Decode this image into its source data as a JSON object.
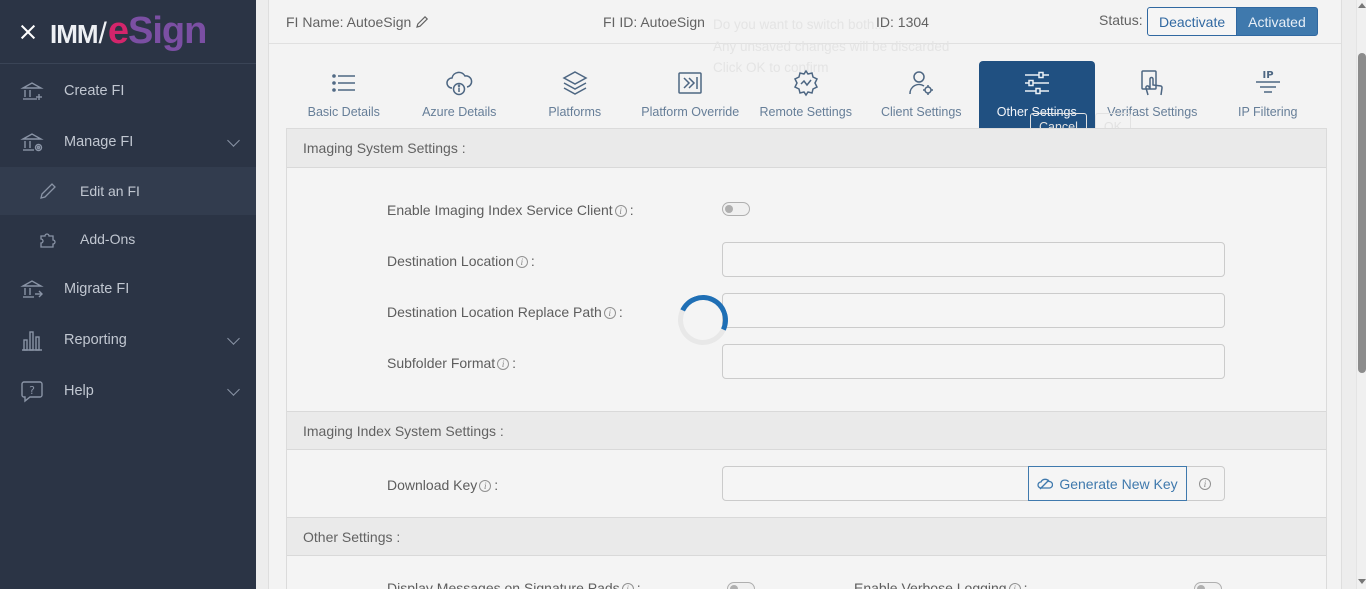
{
  "sidebar": {
    "logo": {
      "part1": "IMM",
      "part2": "e",
      "part3": "Sign"
    },
    "items": [
      {
        "label": "Create FI",
        "icon": "bank-plus-icon"
      },
      {
        "label": "Manage FI",
        "icon": "bank-gear-icon"
      },
      {
        "label": "Edit an FI",
        "icon": "pencil-icon"
      },
      {
        "label": "Add-Ons",
        "icon": "puzzle-icon"
      },
      {
        "label": "Migrate FI",
        "icon": "bank-arrow-icon"
      },
      {
        "label": "Reporting",
        "icon": "bar-chart-icon"
      },
      {
        "label": "Help",
        "icon": "question-bubble-icon"
      }
    ]
  },
  "header": {
    "fi_name": "FI Name: AutoeSign",
    "fi_id": "FI ID: AutoeSign",
    "id": "ID: 1304",
    "status_label": "Status:",
    "deactivate": "Deactivate",
    "activated": "Activated"
  },
  "ghost_dialog": {
    "line1": "Do you want to switch both...",
    "line2": "Any unsaved changes will be discarded",
    "line3": "Click OK to confirm",
    "cancel": "Cancel",
    "ok": "OK"
  },
  "tabs": [
    {
      "label": "Basic Details",
      "icon": "list-icon"
    },
    {
      "label": "Azure Details",
      "icon": "cloud-info-icon"
    },
    {
      "label": "Platforms",
      "icon": "layers-icon"
    },
    {
      "label": "Platform Override",
      "icon": "override-icon"
    },
    {
      "label": "Remote Settings",
      "icon": "remote-gear-icon"
    },
    {
      "label": "Client Settings",
      "icon": "user-gear-icon"
    },
    {
      "label": "Other Settings",
      "icon": "sliders-icon"
    },
    {
      "label": "Verifast Settings",
      "icon": "hand-icon"
    },
    {
      "label": "IP Filtering",
      "icon": "ip-filter-icon"
    }
  ],
  "sections": {
    "imaging_system": {
      "title": "Imaging System Settings :",
      "enable_label": "Enable Imaging Index Service Client",
      "destination_label": "Destination Location",
      "replace_label": "Destination Location Replace Path",
      "subfolder_label": "Subfolder Format"
    },
    "imaging_index": {
      "title": "Imaging Index System Settings :",
      "download_key_label": "Download Key",
      "generate_button": "Generate New Key"
    },
    "other": {
      "title": "Other Settings :",
      "display_messages_label": "Display Messages on Signature Pads",
      "verbose_label": "Enable Verbose Logging"
    }
  },
  "colors": {
    "sidebar_bg": "#2b3445",
    "active_tab": "#0e4277",
    "accent": "#2f6ea6",
    "spinner": "#1f6fb5"
  }
}
